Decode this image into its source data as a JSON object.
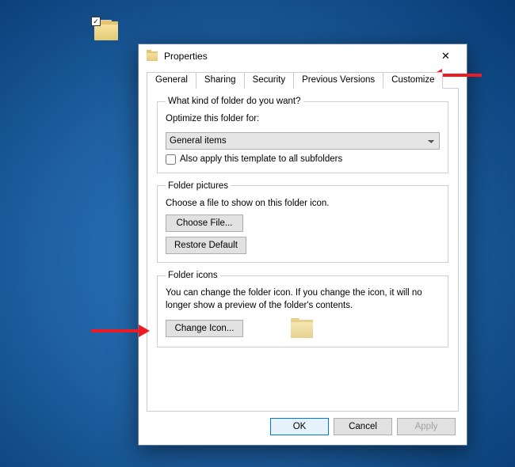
{
  "desktop": {
    "icon_name": "folder-selected"
  },
  "dialog": {
    "title": "Properties",
    "tabs": {
      "general": "General",
      "sharing": "Sharing",
      "security": "Security",
      "previous": "Previous Versions",
      "customize": "Customize"
    },
    "section_kind": {
      "legend": "What kind of folder do you want?",
      "optimize_label": "Optimize this folder for:",
      "combo_selected": "General items",
      "checkbox_label": "Also apply this template to all subfolders",
      "checkbox_checked": false
    },
    "section_pictures": {
      "legend": "Folder pictures",
      "desc": "Choose a file to show on this folder icon.",
      "choose_btn": "Choose File...",
      "restore_btn": "Restore Default"
    },
    "section_icons": {
      "legend": "Folder icons",
      "desc": "You can change the folder icon. If you change the icon, it will no longer show a preview of the folder's contents.",
      "change_btn": "Change Icon..."
    },
    "buttons": {
      "ok": "OK",
      "cancel": "Cancel",
      "apply": "Apply"
    }
  }
}
